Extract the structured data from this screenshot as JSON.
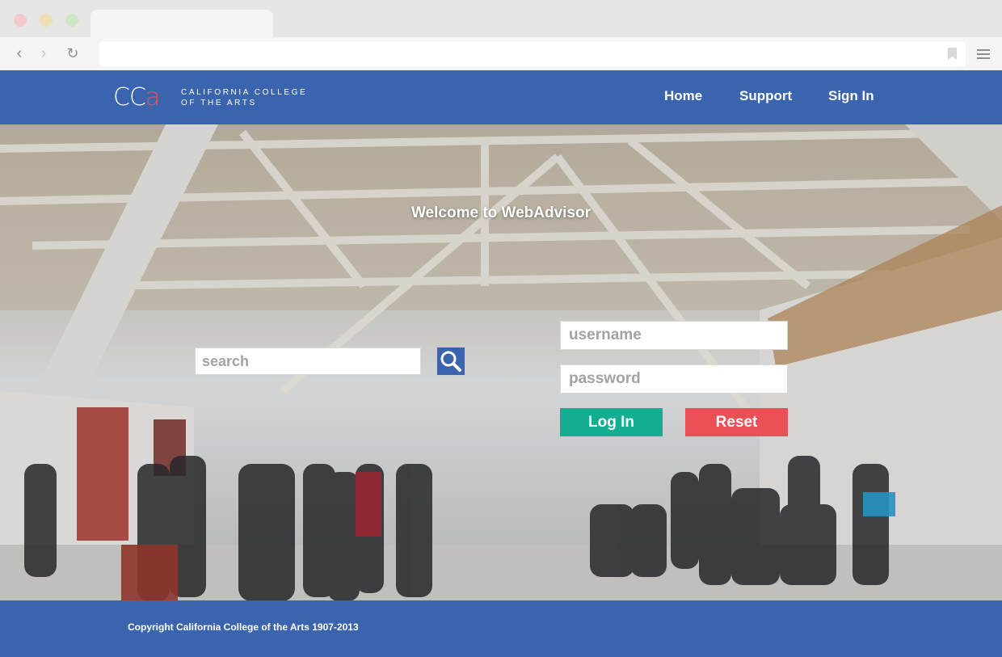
{
  "browser": {
    "back_icon": "chevron-left-icon",
    "forward_icon": "chevron-right-icon",
    "reload_icon": "reload-icon",
    "menu_icon": "hamburger-menu-icon"
  },
  "header": {
    "logo_letters": "CC",
    "logo_accent": "a",
    "logo_line1": "CALIFORNIA COLLEGE",
    "logo_line2": "OF THE ARTS",
    "nav": [
      {
        "label": "Home"
      },
      {
        "label": "Support"
      },
      {
        "label": "Sign In"
      }
    ],
    "color": "#3a64ad"
  },
  "hero": {
    "welcome": "Welcome to WebAdvisor"
  },
  "search": {
    "placeholder": "search",
    "button_icon": "search-icon"
  },
  "login": {
    "username_placeholder": "username",
    "password_placeholder": "password",
    "login_label": "Log In",
    "reset_label": "Reset",
    "login_color": "#15ad8f",
    "reset_color": "#ea5055"
  },
  "footer": {
    "copyright": "Copyright California College of the Arts 1907-2013"
  }
}
